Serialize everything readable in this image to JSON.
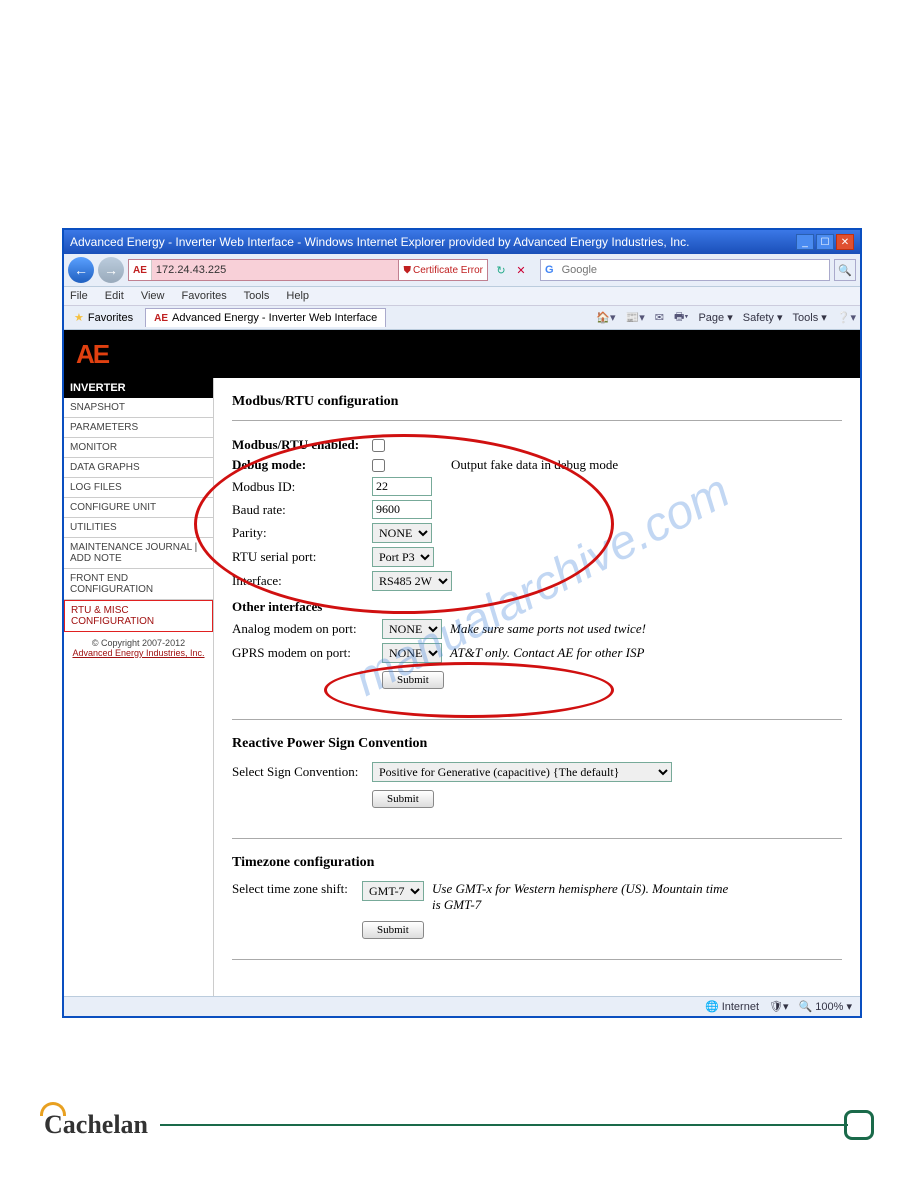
{
  "window": {
    "title": "Advanced Energy - Inverter Web Interface - Windows Internet Explorer provided by Advanced Energy Industries, Inc.",
    "address": "172.24.43.225",
    "cert_error": "Certificate Error",
    "search_placeholder": "Google"
  },
  "menubar": [
    "File",
    "Edit",
    "View",
    "Favorites",
    "Tools",
    "Help"
  ],
  "tabbar": {
    "favorites": "Favorites",
    "tab_title": "Advanced Energy - Inverter Web Interface",
    "toolbar": {
      "page": "Page",
      "safety": "Safety",
      "tools": "Tools"
    }
  },
  "logo": "AE",
  "sidebar": {
    "header": "INVERTER",
    "items": [
      "SNAPSHOT",
      "PARAMETERS",
      "MONITOR",
      "DATA GRAPHS",
      "LOG FILES",
      "CONFIGURE UNIT",
      "UTILITIES",
      "MAINTENANCE JOURNAL | ADD NOTE",
      "FRONT END CONFIGURATION",
      "RTU & MISC CONFIGURATION"
    ],
    "copyright": "© Copyright 2007-2012",
    "company_link": "Advanced Energy Industries, Inc."
  },
  "main": {
    "title1": "Modbus/RTU configuration",
    "rows": {
      "enabled": "Modbus/RTU enabled:",
      "debug": "Debug mode:",
      "debug_note": "Output fake data in debug mode",
      "modbus_id": {
        "label": "Modbus ID:",
        "value": "22"
      },
      "baud": {
        "label": "Baud rate:",
        "value": "9600"
      },
      "parity": {
        "label": "Parity:",
        "value": "NONE"
      },
      "serial": {
        "label": "RTU serial port:",
        "value": "Port P3"
      },
      "interface": {
        "label": "Interface:",
        "value": "RS485 2W"
      }
    },
    "other_head": "Other interfaces",
    "analog": {
      "label": "Analog modem on port:",
      "value": "NONE",
      "note": "Make sure same ports not used twice!"
    },
    "gprs": {
      "label": "GPRS modem on port:",
      "value": "NONE",
      "note": "AT&T only. Contact AE for other ISP"
    },
    "submit": "Submit",
    "title2": "Reactive Power Sign Convention",
    "sign": {
      "label": "Select Sign Convention:",
      "value": "Positive for Generative (capacitive) {The default}"
    },
    "title3": "Timezone configuration",
    "tz": {
      "label": "Select time zone shift:",
      "value": "GMT-7",
      "note": "Use GMT-x for Western hemisphere (US). Mountain time is GMT-7"
    }
  },
  "statusbar": {
    "zone": "Internet",
    "zoom": "100%"
  },
  "watermark": "manualarchive.com",
  "footer_brand": "Cachelan"
}
